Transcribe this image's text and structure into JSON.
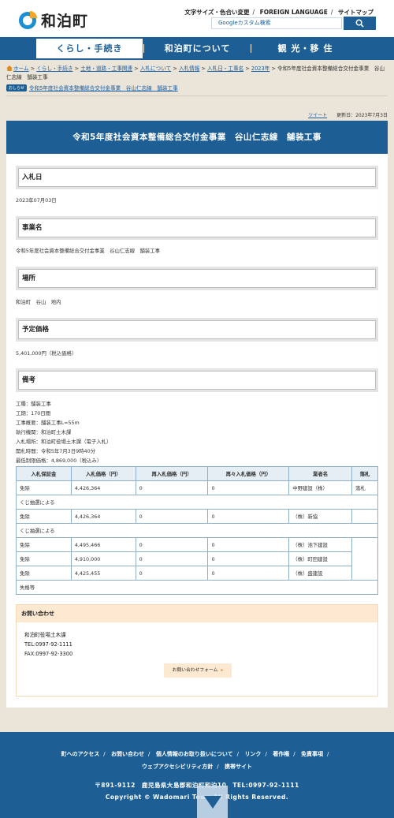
{
  "header": {
    "logo_text": "和泊町",
    "utility": [
      "文字サイズ・色合い変更",
      "FOREIGN LANGUAGE",
      "サイトマップ"
    ],
    "search_placeholder": "Googleカスタム検索"
  },
  "nav": [
    "くらし・手続き",
    "和泊町について",
    "観 光・移 住"
  ],
  "breadcrumb": {
    "items": [
      "ホーム",
      "くらし・手続き",
      "土地・道路・工事関連",
      "入札について",
      "入札情報",
      "入札日・工事名",
      "2023年"
    ],
    "current": "令和5年度社会資本整備総合交付金事業　谷山仁志線　舗装工事"
  },
  "notice": {
    "badge": "おしらせ",
    "link": "令和5年度社会資本整備総合交付金事業　谷山仁志線　舗装工事"
  },
  "meta": {
    "tweet": "ツイート",
    "updated": "更新日：2023年7月3日"
  },
  "page_title": "令和5年度社会資本整備総合交付金事業　谷山仁志線　舗装工事",
  "sections": {
    "bid_date": {
      "heading": "入札日",
      "text": "2023年07月03日"
    },
    "project": {
      "heading": "事業名",
      "text": "令和5年度社会資本整備総合交付金事業　谷山仁志線　舗装工事"
    },
    "location": {
      "heading": "場所",
      "text": "和泊町　谷山　地内"
    },
    "price": {
      "heading": "予定価格",
      "text": "5,401,000円（税込価格）"
    },
    "remarks": {
      "heading": "備考",
      "lines": [
        "工種：舗装工事",
        "工期：170日間",
        "工事概要：舗装工事L=55m",
        "執行機関：和泊町土木課",
        "入札場所：和泊町役場土木課（電子入札）",
        "開札時間：令和5年7月3日9時40分",
        "最低制限価格：4,869,000（税込み）"
      ]
    }
  },
  "table": {
    "headers": [
      "入札保証金",
      "入札価格（円）",
      "再入札価格（円）",
      "再々入札価格（円）",
      "業者名",
      "落札"
    ],
    "row1": [
      "免除",
      "4,426,364",
      "0",
      "0",
      "中野建設（株）",
      "落札"
    ],
    "note1": "くじ抽選による",
    "row2": [
      "免除",
      "4,426,364",
      "0",
      "0",
      "（株）新協",
      ""
    ],
    "note2": "くじ抽選による",
    "row3": [
      "免除",
      "4,495,466",
      "0",
      "0",
      "（株）池下建設"
    ],
    "row4": [
      "免除",
      "4,910,000",
      "0",
      "0",
      "（株）町田建設"
    ],
    "row5": [
      "免除",
      "4,425,455",
      "0",
      "0",
      "（株）盛建設"
    ],
    "note3": "失格等"
  },
  "contact": {
    "heading": "お問い合わせ",
    "org": "和泊町役場土木課",
    "tel": "TEL:0997-92-1111",
    "fax": "FAX:0997-92-3300",
    "button": "お問い合わせフォーム"
  },
  "footer": {
    "links": [
      "町へのアクセス",
      "お問い合わせ",
      "個人情報のお取り扱いについて",
      "リンク",
      "著作権",
      "免責事項",
      "ウェブアクセシビリティ方針",
      "携帯サイト"
    ],
    "address": "〒891-9112　鹿児島県大島郡和泊町和泊10　TEL:0997-92-1111",
    "copyright": "Copyright © Wadomari Town All Rights Reserved."
  }
}
